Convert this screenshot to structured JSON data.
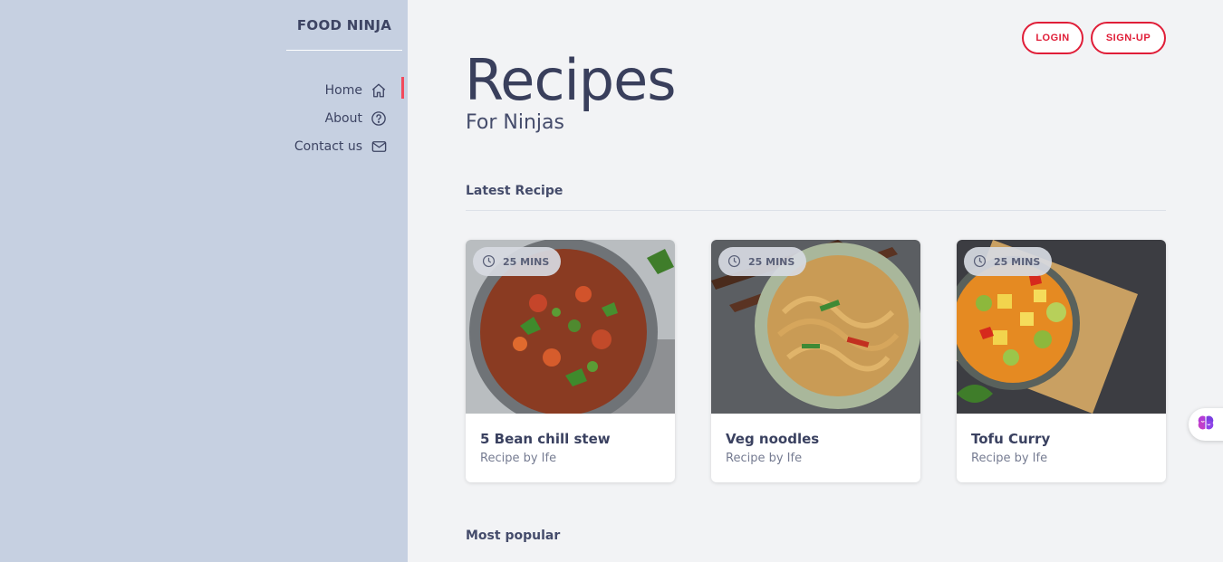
{
  "sidebar": {
    "brand": "FOOD NINJA",
    "items": [
      {
        "label": "Home",
        "icon": "home-icon",
        "active": true
      },
      {
        "label": "About",
        "icon": "question-circle-icon",
        "active": false
      },
      {
        "label": "Contact us",
        "icon": "envelope-icon",
        "active": false
      }
    ]
  },
  "header": {
    "login_label": "LOGIN",
    "signup_label": "SIGN-UP"
  },
  "hero": {
    "title": "Recipes",
    "subtitle": "For Ninjas"
  },
  "sections": {
    "latest": "Latest Recipe",
    "popular": "Most popular"
  },
  "recipes": [
    {
      "time": "25 MINS",
      "title": "5 Bean chill stew",
      "author": "Recipe by Ife"
    },
    {
      "time": "25 MINS",
      "title": "Veg noodles",
      "author": "Recipe by Ife"
    },
    {
      "time": "25 MINS",
      "title": "Tofu Curry",
      "author": "Recipe by Ife"
    }
  ],
  "colors": {
    "sidebar_bg": "#c6d0e1",
    "main_bg": "#f2f3f5",
    "accent": "#e01e38",
    "active_bar": "#f2495b",
    "text_dark": "#3a4160"
  }
}
